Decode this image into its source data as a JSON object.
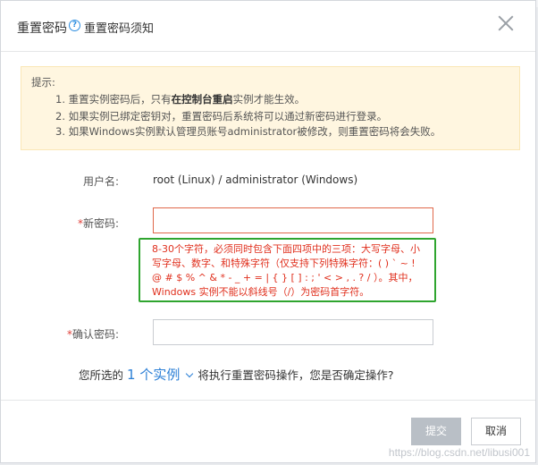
{
  "dialog": {
    "title": "重置密码",
    "help_link": "重置密码须知"
  },
  "notice": {
    "label": "提示:",
    "lines": [
      {
        "pre": "1. 重置实例密码后，只有",
        "bold": "在控制台重启",
        "post": "实例才能生效。"
      },
      {
        "text": "2. 如果实例已绑定密钥对，重置密码后系统将可以通过新密码进行登录。"
      },
      {
        "text": "3. 如果Windows实例默认管理员账号administrator被修改，则重置密码将会失败。"
      }
    ]
  },
  "form": {
    "username_label": "用户名:",
    "username_value": "root (Linux) / administrator (Windows)",
    "new_password_label": "新密码:",
    "new_password_value": "",
    "confirm_password_label": "确认密码:",
    "confirm_password_value": "",
    "required_mark": "*"
  },
  "password_rule": "8-30个字符，必须同时包含下面四项中的三项：大写字母、小写字母、数字、和特殊字符（仅支持下列特殊字符：( ) ` ~ ! @ # $ % ^ & * - _ + = | { } [ ] : ; ' < > , . ? / ）。其中，Windows 实例不能以斜线号（/）为密码首字符。",
  "confirm": {
    "pre": "您所选的",
    "count": "1 个实例",
    "post": "将执行重置密码操作，您是否确定操作?"
  },
  "buttons": {
    "submit": "提交",
    "cancel": "取消"
  },
  "watermark": "https://blog.csdn.net/libusi001"
}
